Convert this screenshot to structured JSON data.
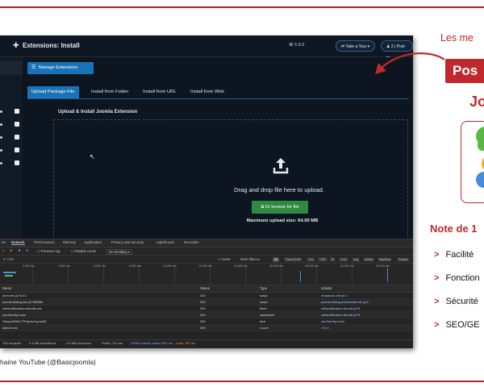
{
  "colors": {
    "accent_red": "#c0282d",
    "joomla_blue": "#1a73b8",
    "browse_green": "#2e8a3e"
  },
  "joomla": {
    "page_title": "Extensions: Install",
    "version": "5.0.0",
    "take_tour": "Take a Tour",
    "notif_count": "2",
    "post_label": "Post In",
    "manage_button": "Manage Extensions",
    "tabs": [
      "Upload Package File",
      "Install from Folder",
      "Install from URL",
      "Install from Web"
    ],
    "section_title": "Upload & Install Joomla Extension",
    "drop_text": "Drag and drop file here to upload.",
    "browse_button": "Or browse for file",
    "max_size": "Maximum upload size: 64.00 MB"
  },
  "devtools": {
    "tabs": [
      "es",
      "Network",
      "Performance",
      "Memory",
      "Application",
      "Privacy and security",
      "Lighthouse",
      "Recorder"
    ],
    "preserve_log": "Preserve log",
    "disable_cache": "Disable cache",
    "throttling": "No throttling",
    "filter_placeholder": "Filter",
    "invert": "Invert",
    "more_filters": "More filters",
    "type_filters": [
      "All",
      "Fetch/XHR",
      "Doc",
      "CSS",
      "JS",
      "Font",
      "Img",
      "Media",
      "Manifest",
      "Socket"
    ],
    "timeline_ticks": [
      "2,000 ms",
      "4,000 ms",
      "6,000 ms",
      "8,000 ms",
      "10,000 ms",
      "12,000 ms",
      "14,000 ms",
      "16,000 ms",
      "18,000 ms",
      "20,000 ms",
      "22,000 ms"
    ],
    "columns": [
      "Name",
      "Status",
      "Type",
      "Initiator"
    ],
    "rows": [
      {
        "name": "dom.min.js?5.0.0",
        "status": "200",
        "type": "script",
        "initiator": "dropdown.min.js:1"
      },
      {
        "name": "joomla-dialog.min.js?2B8f9e",
        "status": "200",
        "type": "script",
        "initiator": "joomla-dialog-autocreate.min.js:1"
      },
      {
        "name": "cdfacd4ficaction.bundle.css",
        "status": "200",
        "type": "fetch",
        "initiator": "cdfacd4fication.bundle.js?5"
      },
      {
        "name": "css?family=Lato",
        "status": "200",
        "type": "stylesheet",
        "initiator": "cdfacd4fication.bundle.js?5"
      },
      {
        "name": "S6uyw4BMUTPHjx4wXg.woff2",
        "status": "200",
        "type": "font",
        "initiator": "css?family=Lato"
      },
      {
        "name": "favicon.ico",
        "status": "200",
        "type": "x-icon",
        "initiator": "Other"
      }
    ],
    "footer": {
      "requests": "139 requests",
      "transferred": "2.4 MB transferred",
      "resources": "4.5 MB resources",
      "finish": "Finish: 731 ms",
      "dcl": "DOMContentLoaded: 592 ms",
      "load": "Load: 787 ms"
    }
  },
  "caption": "haine YouTube (@Basicjoomla)",
  "slide": {
    "heading_partial": "Les me",
    "badge_partial": "Pos",
    "subtitle_partial": "Jo",
    "note_partial": "Note de 1",
    "features": [
      "Facilité",
      "Fonction",
      "Sécurité",
      "SEO/GE"
    ]
  }
}
